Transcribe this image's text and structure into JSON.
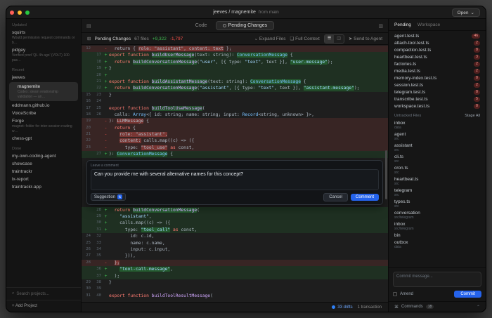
{
  "window": {
    "title": "jeeves / magnemite",
    "branch": "from main",
    "open_button": "Open"
  },
  "left_sidebar": {
    "search_placeholder": "Search projects...",
    "add_project": "+ Add Project",
    "sections": [
      {
        "label": "Updated",
        "items": [
          {
            "name": "squirts",
            "sub": "Would permission request commands or b…"
          },
          {
            "name": "pidgey",
            "sub": "Verified prod 'QL 4h ago' (VOLT) 100 pas…"
          }
        ]
      },
      {
        "label": "Recent",
        "items": [
          {
            "name": "jeeves"
          },
          {
            "name": "magnemite",
            "sub": "Codex: steam relationship validation — an…",
            "selected": true,
            "child": true
          },
          {
            "name": "eddmann.github.io"
          },
          {
            "name": "VoiceScribe"
          },
          {
            "name": "Forge",
            "sub": "magnet: folder for inter-session routing w…"
          },
          {
            "name": "chess-gpt"
          }
        ]
      },
      {
        "label": "Done",
        "items": [
          {
            "name": "my-own-coding-agent"
          },
          {
            "name": "showcase"
          },
          {
            "name": "traintrackr"
          },
          {
            "name": "lx-report"
          },
          {
            "name": "traintrackr-app"
          }
        ]
      }
    ]
  },
  "tabs": {
    "code": "Code",
    "pending": "Pending Changes"
  },
  "info_bar": {
    "title": "Pending Changes",
    "files": "67 files",
    "added": "+9,322",
    "removed": "-1,797",
    "expand": "Expand Files",
    "full_context": "Full Context",
    "send": "Send to Agent"
  },
  "status_bar": {
    "drifts": "33 drifts",
    "transactions": "1 transaction"
  },
  "comment": {
    "label": "Leave a comment",
    "text": "Can you provide me with several alternative names for this concept?",
    "suggestion": "Suggestion",
    "cancel": "Cancel",
    "submit": "Comment"
  },
  "diff": {
    "lines": [
      {
        "l": "12",
        "r": "",
        "t": "del",
        "segs": [
          [
            "p",
            "  return { "
          ],
          [
            "h",
            "role: \"assistant\", content: text"
          ],
          [
            "p",
            " };"
          ]
        ]
      },
      {
        "l": "",
        "r": "17",
        "t": "add",
        "segs": [
          [
            "k",
            "export function "
          ],
          [
            "fh",
            "buildUserMessage"
          ],
          [
            "p",
            "(text: string): "
          ],
          [
            "th",
            "ConversationMessage"
          ],
          [
            "p",
            " {"
          ]
        ]
      },
      {
        "l": "",
        "r": "18",
        "t": "add",
        "segs": [
          [
            "k",
            "  return "
          ],
          [
            "fh",
            "buildConversationMessage"
          ],
          [
            "p",
            "("
          ],
          [
            "s",
            "\"user\""
          ],
          [
            "p",
            ", [{ type: "
          ],
          [
            "s",
            "\"text\""
          ],
          [
            "p",
            ", text }], "
          ],
          [
            "sh",
            "\"user-message\""
          ],
          [
            "p",
            ");"
          ]
        ]
      },
      {
        "l": "",
        "r": "19",
        "t": "add",
        "segs": [
          [
            "p",
            "}"
          ]
        ]
      },
      {
        "l": "",
        "r": "20",
        "t": "add",
        "segs": [
          [
            "p",
            ""
          ]
        ]
      },
      {
        "l": "",
        "r": "21",
        "t": "add",
        "segs": [
          [
            "k",
            "export function "
          ],
          [
            "fh",
            "buildAssistantMessage"
          ],
          [
            "p",
            "(text: string): "
          ],
          [
            "th",
            "ConversationMessage"
          ],
          [
            "p",
            " {"
          ]
        ]
      },
      {
        "l": "",
        "r": "22",
        "t": "add",
        "segs": [
          [
            "k",
            "  return "
          ],
          [
            "fh",
            "buildConversationMessage"
          ],
          [
            "p",
            "("
          ],
          [
            "s",
            "\"assistant\""
          ],
          [
            "p",
            ", [{ type: "
          ],
          [
            "s",
            "\"text\""
          ],
          [
            "p",
            ", text }], "
          ],
          [
            "sh",
            "\"assistant-message\""
          ],
          [
            "p",
            ");"
          ]
        ]
      },
      {
        "l": "15",
        "r": "23",
        "t": "ctx",
        "segs": [
          [
            "p",
            "}"
          ]
        ]
      },
      {
        "l": "16",
        "r": "24",
        "t": "ctx",
        "segs": [
          [
            "p",
            ""
          ]
        ]
      },
      {
        "l": "17",
        "r": "25",
        "t": "ctx",
        "segs": [
          [
            "k",
            "export function "
          ],
          [
            "fh",
            "buildToolUseMessage"
          ],
          [
            "p",
            "("
          ]
        ]
      },
      {
        "l": "18",
        "r": "26",
        "t": "ctx",
        "segs": [
          [
            "p",
            "  calls: "
          ],
          [
            "t",
            "Array"
          ],
          [
            "p",
            "<{ id: string; name: string; input: "
          ],
          [
            "t",
            "Record"
          ],
          [
            "p",
            "<string, unknown> }>,"
          ]
        ]
      },
      {
        "l": "19",
        "r": "",
        "t": "del",
        "segs": [
          [
            "p",
            "): "
          ],
          [
            "h",
            "LLMMessage"
          ],
          [
            "p",
            " {"
          ]
        ]
      },
      {
        "l": "20",
        "r": "",
        "t": "del",
        "segs": [
          [
            "k",
            "  return"
          ],
          [
            "p",
            " {"
          ]
        ]
      },
      {
        "l": "21",
        "r": "",
        "t": "del",
        "segs": [
          [
            "p",
            "    "
          ],
          [
            "h",
            "role: \"assistant\","
          ]
        ]
      },
      {
        "l": "22",
        "r": "",
        "t": "del",
        "segs": [
          [
            "p",
            "    "
          ],
          [
            "h",
            "content:"
          ],
          [
            "p",
            " calls.map((c) => ({"
          ]
        ]
      },
      {
        "l": "23",
        "r": "",
        "t": "del",
        "segs": [
          [
            "p",
            "      type: "
          ],
          [
            "h",
            "\"tool_use\""
          ],
          [
            "p",
            " "
          ],
          [
            "k",
            "as"
          ],
          [
            "p",
            " const,"
          ]
        ]
      },
      {
        "l": "",
        "r": "27",
        "t": "add",
        "comment_after": true,
        "segs": [
          [
            "p",
            "): "
          ],
          [
            "th",
            "ConversationMessage"
          ],
          [
            "p",
            " {"
          ]
        ]
      },
      {
        "l": "",
        "r": "28",
        "t": "add",
        "segs": [
          [
            "k",
            "  return "
          ],
          [
            "fh",
            "buildConversationMessage"
          ],
          [
            "p",
            "("
          ]
        ]
      },
      {
        "l": "",
        "r": "29",
        "t": "add",
        "segs": [
          [
            "p",
            "    "
          ],
          [
            "s",
            "\"assistant\""
          ],
          [
            "p",
            ","
          ]
        ]
      },
      {
        "l": "",
        "r": "30",
        "t": "add",
        "segs": [
          [
            "p",
            "    calls.map((c) => ({"
          ]
        ]
      },
      {
        "l": "",
        "r": "31",
        "t": "add",
        "segs": [
          [
            "p",
            "      type: "
          ],
          [
            "sh",
            "\"tool_call\""
          ],
          [
            "p",
            " "
          ],
          [
            "k",
            "as"
          ],
          [
            "p",
            " const,"
          ]
        ]
      },
      {
        "l": "24",
        "r": "32",
        "t": "ctx",
        "segs": [
          [
            "p",
            "        id: c.id,"
          ]
        ]
      },
      {
        "l": "25",
        "r": "33",
        "t": "ctx",
        "segs": [
          [
            "p",
            "        name: c.name,"
          ]
        ]
      },
      {
        "l": "26",
        "r": "34",
        "t": "ctx",
        "segs": [
          [
            "p",
            "        input: c.input,"
          ]
        ]
      },
      {
        "l": "27",
        "r": "35",
        "t": "ctx",
        "segs": [
          [
            "p",
            "      })),"
          ]
        ]
      },
      {
        "l": "28",
        "r": "",
        "t": "del",
        "segs": [
          [
            "p",
            "  "
          ],
          [
            "h",
            "};"
          ]
        ]
      },
      {
        "l": "",
        "r": "36",
        "t": "add",
        "segs": [
          [
            "p",
            "    "
          ],
          [
            "sh",
            "\"tool-call-message\""
          ],
          [
            "p",
            ","
          ]
        ]
      },
      {
        "l": "",
        "r": "37",
        "t": "add",
        "segs": [
          [
            "p",
            "  );"
          ]
        ]
      },
      {
        "l": "29",
        "r": "38",
        "t": "ctx",
        "segs": [
          [
            "p",
            "}"
          ]
        ]
      },
      {
        "l": "30",
        "r": "39",
        "t": "ctx",
        "segs": [
          [
            "p",
            ""
          ]
        ]
      },
      {
        "l": "31",
        "r": "40",
        "t": "ctx",
        "segs": [
          [
            "k",
            "export function "
          ],
          [
            "f",
            "buildToolResultMessage"
          ],
          [
            "p",
            "("
          ]
        ]
      }
    ]
  },
  "right_sidebar": {
    "tabs": [
      "Pending",
      "Workspace"
    ],
    "pending_files": [
      {
        "name": "agent.test.ts",
        "badge": "46"
      },
      {
        "name": "attach-tool.test.ts",
        "badge": "2"
      },
      {
        "name": "compaction.test.ts",
        "badge": "8"
      },
      {
        "name": "heartbeat.test.ts",
        "badge": "3"
      },
      {
        "name": "factories.ts",
        "badge": "2"
      },
      {
        "name": "media.test.ts",
        "badge": "2"
      },
      {
        "name": "memory-index.test.ts",
        "badge": "8"
      },
      {
        "name": "session.test.ts",
        "badge": "2"
      },
      {
        "name": "telegram.test.ts",
        "badge": "8"
      },
      {
        "name": "transcribe.test.ts",
        "badge": "5"
      },
      {
        "name": "workspace.test.ts",
        "badge": "8"
      }
    ],
    "untracked": {
      "label": "Untracked Files",
      "stage_all": "Stage All",
      "items": [
        {
          "name": "inbox",
          "sub": "data"
        },
        {
          "name": "agent",
          "sub": "src"
        },
        {
          "name": "assistant",
          "sub": "src"
        },
        {
          "name": "cli.ts",
          "sub": "src"
        },
        {
          "name": "cron.ts",
          "sub": "src"
        },
        {
          "name": "heartbeat.ts",
          "sub": "src"
        },
        {
          "name": "telegram",
          "sub": "src"
        },
        {
          "name": "types.ts",
          "sub": "src"
        },
        {
          "name": "conversation",
          "sub": "src/telegram"
        },
        {
          "name": "inbox",
          "sub": "src/telegram"
        },
        {
          "name": "bin",
          "sub": ""
        },
        {
          "name": "outbox",
          "sub": "data"
        }
      ]
    },
    "commit": {
      "placeholder": "Commit message...",
      "amend": "Amend",
      "button": "Commit"
    },
    "commands": {
      "label": "Commands",
      "badge": "18"
    }
  }
}
